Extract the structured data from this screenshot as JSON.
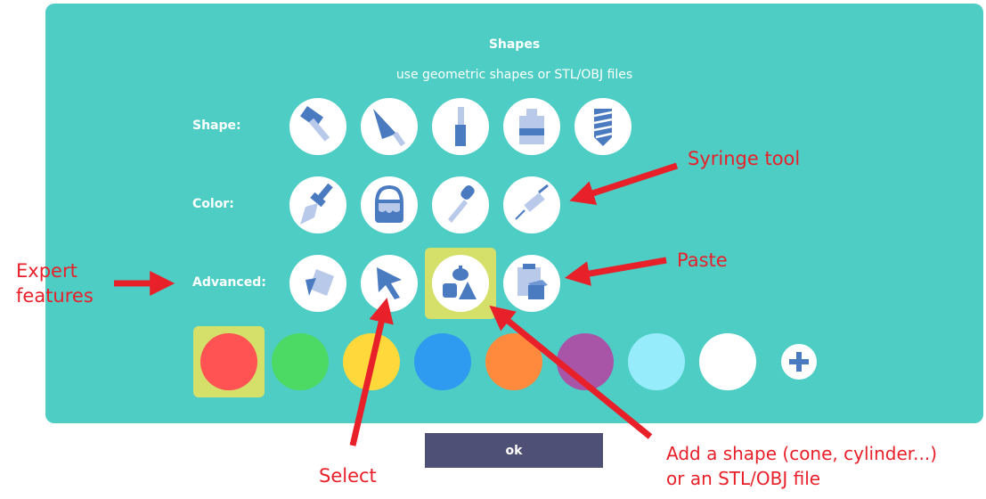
{
  "dialog": {
    "title": "Shapes",
    "subtitle": "use geometric shapes or STL/OBJ files"
  },
  "rows": {
    "shape_label": "Shape:",
    "color_label": "Color:",
    "advanced_label": "Advanced:"
  },
  "shape_tools": [
    "hammer-icon",
    "trowel-icon",
    "chisel-icon",
    "glue-bottle-icon",
    "drill-bit-icon"
  ],
  "color_tools": [
    "paint-brush-icon",
    "paint-bucket-icon",
    "dropper-icon",
    "syringe-icon"
  ],
  "advanced_tools": [
    "transform-icon",
    "select-arrow-icon",
    "add-shape-icon",
    "paste-icon"
  ],
  "selected_advanced_tool": "add-shape-icon",
  "palette": {
    "colors": [
      "#ff5252",
      "#4cd964",
      "#ffd93b",
      "#2e9bf0",
      "#ff8a3d",
      "#a855a8",
      "#96ecfb",
      "#ffffff"
    ],
    "selected_color": "#ff5252",
    "add_label": "+"
  },
  "theme": {
    "panel_bg": "#4ecdc4",
    "highlight": "#d4e06a",
    "icon_blue": "#4a7bc1",
    "icon_light": "#b9c9ea",
    "ok_bg": "#4f5075",
    "annotation": "#e8202a"
  },
  "ok_button": {
    "label": "ok"
  },
  "annotations": {
    "syringe": "Syringe tool",
    "paste": "Paste",
    "expert_line1": "Expert",
    "expert_line2": "features",
    "select": "Select",
    "add_shape_line1": "Add a shape (cone, cylinder...)",
    "add_shape_line2": "or an STL/OBJ file"
  }
}
